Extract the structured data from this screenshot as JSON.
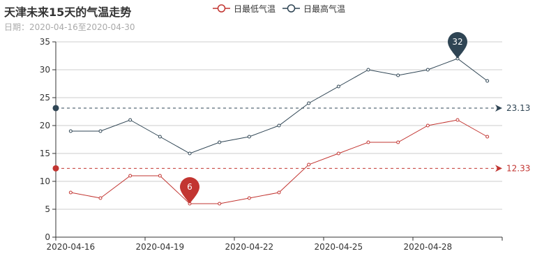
{
  "chart_data": {
    "type": "line",
    "title": "天津未来15天的气温走势",
    "subtitle": "日期：2020-04-16至2020-04-30",
    "categories": [
      "2020-04-16",
      "2020-04-17",
      "2020-04-18",
      "2020-04-19",
      "2020-04-20",
      "2020-04-21",
      "2020-04-22",
      "2020-04-23",
      "2020-04-24",
      "2020-04-25",
      "2020-04-26",
      "2020-04-27",
      "2020-04-28",
      "2020-04-29",
      "2020-04-30"
    ],
    "x_tick_labels": [
      "2020-04-16",
      "2020-04-19",
      "2020-04-22",
      "2020-04-25",
      "2020-04-28"
    ],
    "series": [
      {
        "name": "日最低气温",
        "color": "#c23531",
        "values": [
          8,
          7,
          11,
          11,
          6,
          6,
          7,
          8,
          13,
          15,
          17,
          17,
          20,
          21,
          18
        ],
        "min_pin": {
          "category": "2020-04-20",
          "value": 6,
          "label": "6"
        },
        "average": {
          "value": 12.33,
          "label": "12.33"
        }
      },
      {
        "name": "日最高气温",
        "color": "#2f4554",
        "values": [
          19,
          19,
          21,
          18,
          15,
          17,
          18,
          20,
          24,
          27,
          30,
          29,
          30,
          32,
          28
        ],
        "max_pin": {
          "category": "2020-04-29",
          "value": 32,
          "label": "32"
        },
        "average": {
          "value": 23.13,
          "label": "23.13"
        }
      }
    ],
    "y_ticks": [
      0,
      5,
      10,
      15,
      20,
      25,
      30,
      35
    ],
    "ylim": [
      0,
      35
    ],
    "grid": true,
    "legend_position": "top-center"
  }
}
